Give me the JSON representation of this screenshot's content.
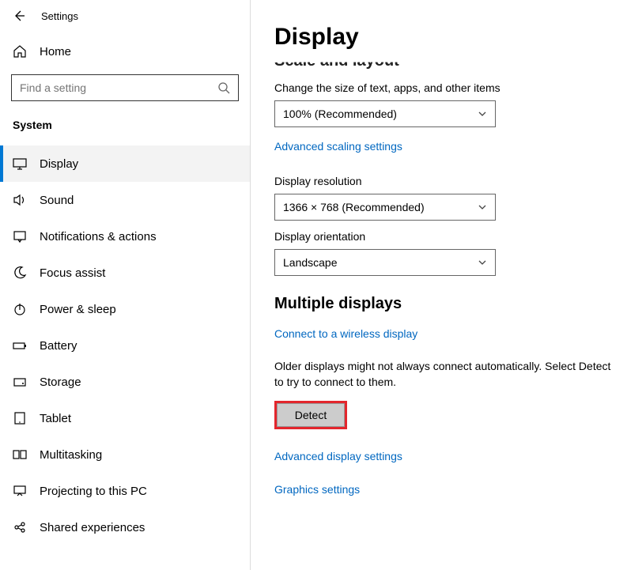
{
  "header": {
    "title": "Settings"
  },
  "home": {
    "label": "Home"
  },
  "search": {
    "placeholder": "Find a setting"
  },
  "category": "System",
  "sidebar": {
    "items": [
      {
        "label": "Display"
      },
      {
        "label": "Sound"
      },
      {
        "label": "Notifications & actions"
      },
      {
        "label": "Focus assist"
      },
      {
        "label": "Power & sleep"
      },
      {
        "label": "Battery"
      },
      {
        "label": "Storage"
      },
      {
        "label": "Tablet"
      },
      {
        "label": "Multitasking"
      },
      {
        "label": "Projecting to this PC"
      },
      {
        "label": "Shared experiences"
      }
    ]
  },
  "main": {
    "title": "Display",
    "scale_section": "Scale and layout",
    "scale_label": "Change the size of text, apps, and other items",
    "scale_value": "100% (Recommended)",
    "adv_scaling": "Advanced scaling settings",
    "resolution_label": "Display resolution",
    "resolution_value": "1366 × 768 (Recommended)",
    "orientation_label": "Display orientation",
    "orientation_value": "Landscape",
    "multi_heading": "Multiple displays",
    "connect_link": "Connect to a wireless display",
    "older_text": "Older displays might not always connect automatically. Select Detect to try to connect to them.",
    "detect_button": "Detect",
    "adv_display": "Advanced display settings",
    "graphics": "Graphics settings"
  }
}
